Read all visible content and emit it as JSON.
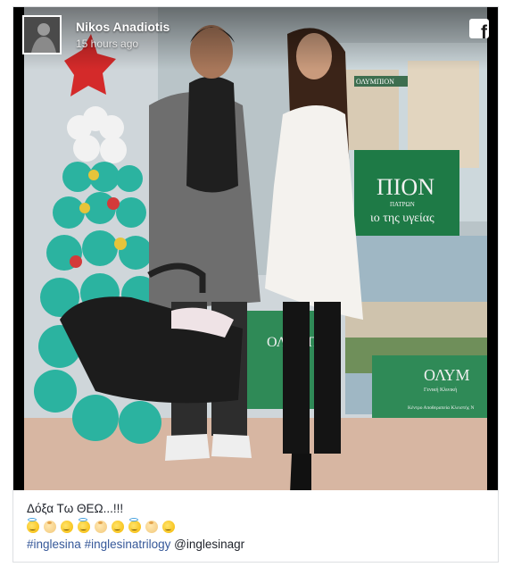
{
  "post": {
    "author_name": "Nikos Anadiotis",
    "timestamp": "15 hours ago",
    "brand_icon": "facebook-f-icon",
    "caption_text": "Δόξα Τω ΘΕΩ...!!!",
    "emojis": [
      "angel-halo",
      "baby",
      "baby-face",
      "angel-halo",
      "baby",
      "baby-face",
      "angel-halo",
      "baby",
      "baby-face"
    ],
    "hashtags": [
      "#inglesina",
      "#inglesinatrilogy"
    ],
    "mention": "@inglesinagr"
  },
  "photo_signage": {
    "top_sign": "ΟΛΥΜΠΙΟΝ",
    "green_sign_main": "ΠΙΟΝ",
    "green_sign_sub": "ιο της υγείας",
    "green_sign_small": "ΠΑΤΡΩΝ",
    "lower_sign_main": "ΟΛΥΜ",
    "lower_sign_sub": "Γενική Κλινική",
    "lower_sign_small": "Κέντρο Αποθεραπεία Κλειστής Ν",
    "lower_left_sign": "ΟΛΥΜΠΙ"
  },
  "colors": {
    "link": "#365899",
    "text": "#1d2129",
    "border": "#dddfe2"
  }
}
